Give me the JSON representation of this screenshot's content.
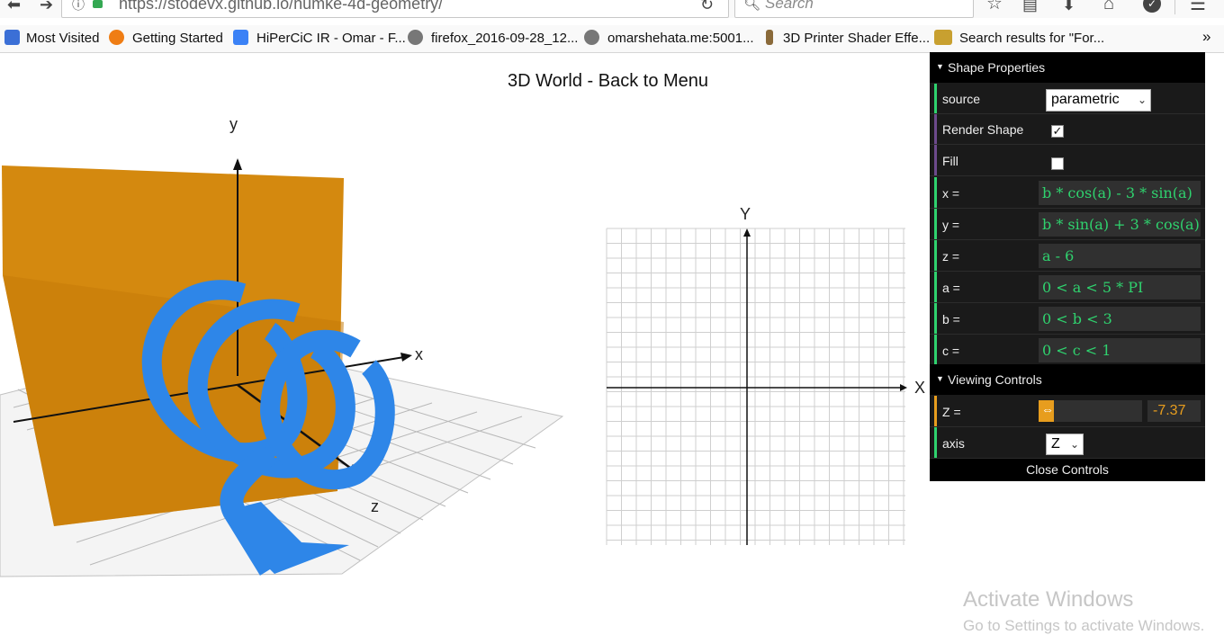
{
  "browser": {
    "url": "https://stodevx.github.io/numke-4d-geometry/",
    "search_placeholder": "Search",
    "bookmarks": [
      {
        "label": "Most Visited",
        "icon": "bookmark-folder-icon"
      },
      {
        "label": "Getting Started",
        "icon": "firefox-icon"
      },
      {
        "label": "HiPerCiC IR - Omar - F...",
        "icon": "google-docs-icon"
      },
      {
        "label": "firefox_2016-09-28_12...",
        "icon": "globe-icon"
      },
      {
        "label": "omarshehata.me:5001...",
        "icon": "globe-icon"
      },
      {
        "label": "3D Printer Shader Effe...",
        "icon": "figure-icon"
      },
      {
        "label": "Search results for \"For...",
        "icon": "site-icon"
      }
    ],
    "overflow_label": "»"
  },
  "page": {
    "title": "3D World - Back to Menu",
    "view3d": {
      "axis_x": "x",
      "axis_y": "y",
      "axis_z": "z"
    },
    "view2d": {
      "axis_x": "X",
      "axis_y": "Y"
    }
  },
  "panel": {
    "shape_header": "Shape Properties",
    "source_label": "source",
    "source_value": "parametric",
    "render_label": "Render Shape",
    "render_checked": true,
    "render_check_mark": "✓",
    "fill_label": "Fill",
    "fill_checked": false,
    "equations": [
      {
        "label": "x =",
        "value": "b * cos(a) - 3 * sin(a)"
      },
      {
        "label": "y =",
        "value": "b * sin(a) + 3 * cos(a)"
      },
      {
        "label": "z =",
        "value": "a - 6"
      },
      {
        "label": "a =",
        "value": "0 < a < 5 * PI"
      },
      {
        "label": "b =",
        "value": "0 < b < 3"
      },
      {
        "label": "c =",
        "value": "0 < c < 1"
      }
    ],
    "viewing_header": "Viewing Controls",
    "z_label": "Z =",
    "z_value": "-7.37",
    "axis_label": "axis",
    "axis_value": "Z",
    "close_label": "Close Controls"
  },
  "watermark": {
    "line1": "Activate Windows",
    "line2": "Go to Settings to activate Windows."
  },
  "colors": {
    "shape": "#2e86e8",
    "plane": "#d4890f",
    "equation_text": "#2fd26e",
    "slider_fill": "#e79d1e",
    "panel_bg": "#1a1a1a"
  }
}
